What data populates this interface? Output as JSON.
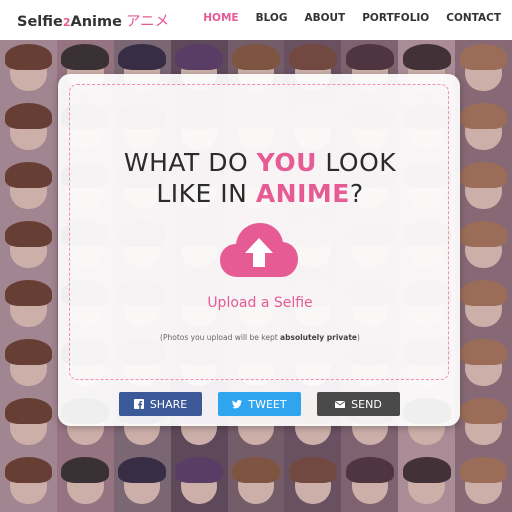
{
  "brand": {
    "name_prefix": "Selfie",
    "name_two": "2",
    "name_suffix": "Anime",
    "japanese": "アニメ"
  },
  "nav": {
    "items": [
      {
        "label": "HOME",
        "active": true
      },
      {
        "label": "BLOG",
        "active": false
      },
      {
        "label": "ABOUT",
        "active": false
      },
      {
        "label": "PORTFOLIO",
        "active": false
      },
      {
        "label": "CONTACT",
        "active": false
      }
    ]
  },
  "hero": {
    "line1_a": "WHAT DO ",
    "line1_b": "YOU",
    "line1_c": " LOOK",
    "line2_a": "LIKE IN ",
    "line2_b": "ANIME",
    "line2_c": "?"
  },
  "upload": {
    "icon": "cloud-upload-icon",
    "label": "Upload a Selfie",
    "privacy_a": "(Photos you upload will be kept ",
    "privacy_b": "absolutely private",
    "privacy_c": ")"
  },
  "share": {
    "facebook_label": "SHARE",
    "twitter_label": "TWEET",
    "email_label": "SEND"
  },
  "colors": {
    "accent": "#e75b95",
    "facebook": "#3b5998",
    "twitter": "#2fa5f0",
    "email": "#4a4a4a"
  }
}
